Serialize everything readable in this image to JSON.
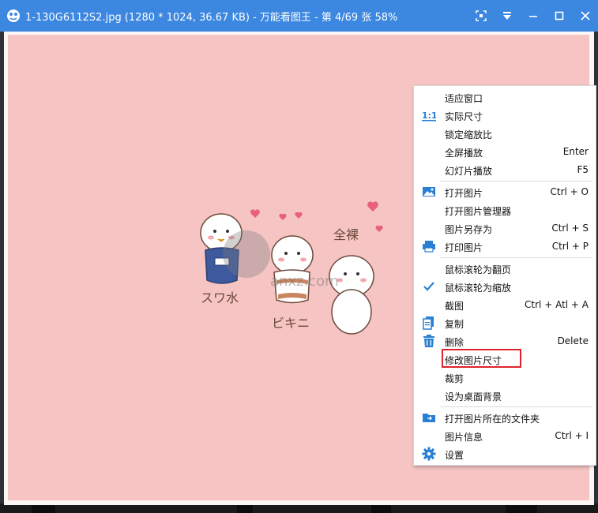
{
  "window": {
    "title": "1-130G6112S2.jpg (1280 * 1024, 36.67 KB) - 万能看图王 - 第 4/69 张 58%",
    "accent": "#3c87e0"
  },
  "image": {
    "background": "#f5c4c3",
    "texts": [
      "スワ水",
      "ビキニ",
      "全裸"
    ],
    "watermark_text": "anxz.com"
  },
  "menu": {
    "items": [
      {
        "label": "适应窗口",
        "shortcut": "",
        "icon": ""
      },
      {
        "label": "实际尺寸",
        "shortcut": "",
        "icon": "actual-size-icon"
      },
      {
        "label": "锁定缩放比",
        "shortcut": "",
        "icon": ""
      },
      {
        "label": "全屏播放",
        "shortcut": "Enter",
        "icon": ""
      },
      {
        "label": "幻灯片播放",
        "shortcut": "F5",
        "icon": ""
      },
      {
        "label": "打开图片",
        "shortcut": "Ctrl + O",
        "icon": "image-icon"
      },
      {
        "label": "打开图片管理器",
        "shortcut": "",
        "icon": ""
      },
      {
        "label": "图片另存为",
        "shortcut": "Ctrl + S",
        "icon": ""
      },
      {
        "label": "打印图片",
        "shortcut": "Ctrl + P",
        "icon": "printer-icon"
      },
      {
        "label": "鼠标滚轮为翻页",
        "shortcut": "",
        "icon": ""
      },
      {
        "label": "鼠标滚轮为缩放",
        "shortcut": "",
        "icon": "checkmark-icon"
      },
      {
        "label": "截图",
        "shortcut": "Ctrl + Atl + A",
        "icon": ""
      },
      {
        "label": "复制",
        "shortcut": "",
        "icon": "copy-icon"
      },
      {
        "label": "删除",
        "shortcut": "Delete",
        "icon": "trash-icon"
      },
      {
        "label": "修改图片尺寸",
        "shortcut": "",
        "icon": ""
      },
      {
        "label": "裁剪",
        "shortcut": "",
        "icon": ""
      },
      {
        "label": "设为桌面背景",
        "shortcut": "",
        "icon": ""
      },
      {
        "label": "打开图片所在的文件夹",
        "shortcut": "",
        "icon": "folder-icon"
      },
      {
        "label": "图片信息",
        "shortcut": "Ctrl + I",
        "icon": ""
      },
      {
        "label": "设置",
        "shortcut": "",
        "icon": "gear-icon"
      }
    ],
    "highlighted_index": 14,
    "highlight_color": "#e0232a"
  }
}
